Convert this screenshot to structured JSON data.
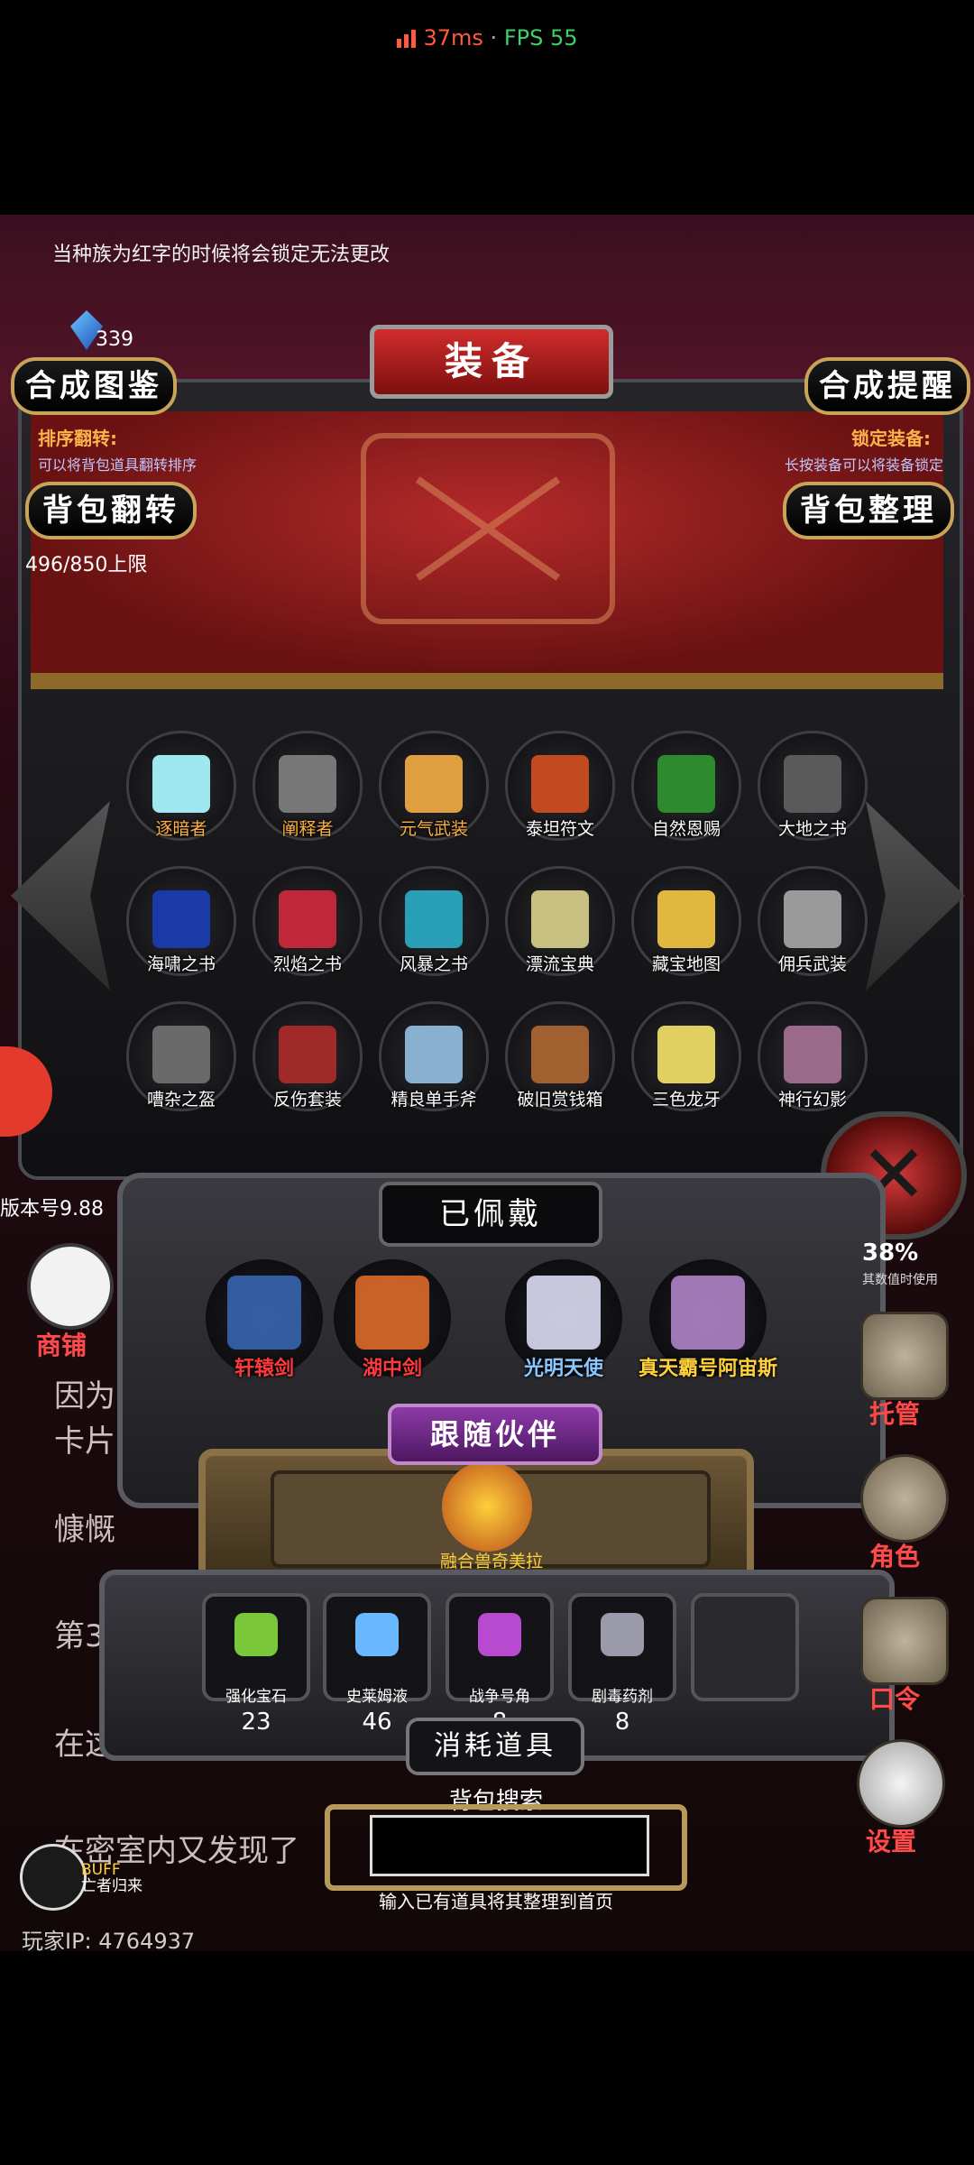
{
  "status": {
    "ping": "37ms",
    "separator": " · ",
    "fps": "FPS 55"
  },
  "notice": "当种族为红字的时候将会锁定无法更改",
  "currency": {
    "amount": "339"
  },
  "header": {
    "title": "装备",
    "recipe_button": "合成图鉴",
    "reminder_button": "合成提醒",
    "sort_flip_title": "排序翻转:",
    "sort_flip_hint": "可以将背包道具翻转排序",
    "lock_title": "锁定装备:",
    "lock_hint": "长按装备可以将装备锁定",
    "flip_button": "背包翻转",
    "organize_button": "背包整理",
    "capacity": "496/850上限"
  },
  "inventory": [
    {
      "name": "逐暗者",
      "icon": "ice-sword-icon",
      "gold": true
    },
    {
      "name": "阐释者",
      "icon": "dark-sword-icon",
      "gold": true
    },
    {
      "name": "元气武装",
      "icon": "hero-armor-icon",
      "gold": true
    },
    {
      "name": "泰坦符文",
      "icon": "rune-stone-icon",
      "gold": false
    },
    {
      "name": "自然恩赐",
      "icon": "green-gem-icon",
      "gold": false
    },
    {
      "name": "大地之书",
      "icon": "gray-book-icon",
      "gold": false
    },
    {
      "name": "海啸之书",
      "icon": "blue-book-icon",
      "gold": false
    },
    {
      "name": "烈焰之书",
      "icon": "red-book-icon",
      "gold": false
    },
    {
      "name": "风暴之书",
      "icon": "teal-book-icon",
      "gold": false
    },
    {
      "name": "漂流宝典",
      "icon": "yellow-book-icon",
      "gold": false
    },
    {
      "name": "藏宝地图",
      "icon": "treasure-map-icon",
      "gold": false
    },
    {
      "name": "佣兵武装",
      "icon": "knight-armor-icon",
      "gold": false
    },
    {
      "name": "嘈杂之盔",
      "icon": "helmet-icon",
      "gold": false
    },
    {
      "name": "反伤套装",
      "icon": "spiked-armor-icon",
      "gold": false
    },
    {
      "name": "精良单手斧",
      "icon": "axe-icon",
      "gold": false
    },
    {
      "name": "破旧赏钱箱",
      "icon": "chest-icon",
      "gold": false
    },
    {
      "name": "三色龙牙",
      "icon": "dragon-fang-icon",
      "gold": false
    },
    {
      "name": "神行幻影",
      "icon": "phantom-icon",
      "gold": false
    }
  ],
  "equipped": {
    "title": "已佩戴",
    "items": [
      {
        "name": "轩辕剑",
        "icon": "xuanyuan-sword-icon"
      },
      {
        "name": "湖中剑",
        "icon": "excalibur-icon"
      },
      {
        "name": "光明天使",
        "icon": "angel-icon"
      },
      {
        "name": "真天霸号阿宙斯",
        "icon": "mecha-icon"
      }
    ]
  },
  "companion": {
    "title": "跟随伙伴",
    "name": "融合兽奇美拉",
    "icon": "chimera-icon"
  },
  "consumables": {
    "title": "消耗道具",
    "items": [
      {
        "name": "强化宝石",
        "count": "23",
        "icon": "green-stone-icon"
      },
      {
        "name": "史莱姆液",
        "count": "46",
        "icon": "potion-bottle-icon"
      },
      {
        "name": "战争号角",
        "count": "8",
        "icon": "war-horn-icon"
      },
      {
        "name": "剧毒药剂",
        "count": "8",
        "icon": "poison-flask-icon"
      }
    ]
  },
  "search": {
    "title": "背包搜索",
    "hint": "输入已有道具将其整理到首页"
  },
  "sidebar": {
    "shop": "商铺",
    "version": "版本号9.88",
    "dice_label": "托管",
    "role_label": "角色",
    "code_label": "口令",
    "settings_label": "设置",
    "stat_value": "38%",
    "stat_hint": "其数值时使用"
  },
  "background_text": [
    "因为",
    "卡片",
    "慷慨",
    "第30",
    "在这",
    "在密室内又发现了"
  ],
  "buff": {
    "label": "BUFF",
    "sub": "亡者归来"
  },
  "player_ip": "玩家IP: 4764937",
  "colors": {
    "accent_red": "#d12c2c",
    "gold": "#ffb040",
    "label_red": "#ff4a4a"
  }
}
